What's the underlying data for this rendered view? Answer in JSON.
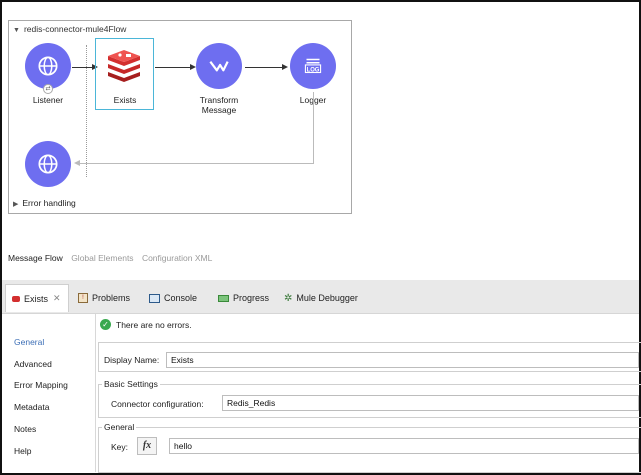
{
  "flow": {
    "title": "redis-connector-mule4Flow",
    "nodes": [
      {
        "label": "Listener",
        "icon": "globe-icon"
      },
      {
        "label": "Exists",
        "icon": "redis-icon"
      },
      {
        "label": "Transform Message",
        "icon": "transform-icon"
      },
      {
        "label": "Logger",
        "icon": "logger-icon"
      }
    ],
    "return_node_icon": "globe-icon",
    "logger_icon_text": "LOG",
    "error_handling": "Error handling"
  },
  "editor_tabs": [
    "Message Flow",
    "Global Elements",
    "Configuration XML"
  ],
  "view_tabs": {
    "exists": "Exists",
    "problems": "Problems",
    "console": "Console",
    "progress": "Progress",
    "debugger": "Mule Debugger"
  },
  "sidebar": [
    "General",
    "Advanced",
    "Error Mapping",
    "Metadata",
    "Notes",
    "Help"
  ],
  "status": "There are no errors.",
  "form": {
    "display_name_label": "Display Name:",
    "display_name_value": "Exists",
    "basic_settings_title": "Basic Settings",
    "connector_config_label": "Connector configuration:",
    "connector_config_value": "Redis_Redis",
    "general_title": "General",
    "key_label": "Key:",
    "fx_label": "fx",
    "key_value": "hello"
  },
  "colors": {
    "node": "#6e6ef0",
    "redis": "#d32f2f",
    "selection": "#4bb6d8",
    "sidebar_active": "#3d6fb6",
    "ok": "#3aa94f"
  }
}
